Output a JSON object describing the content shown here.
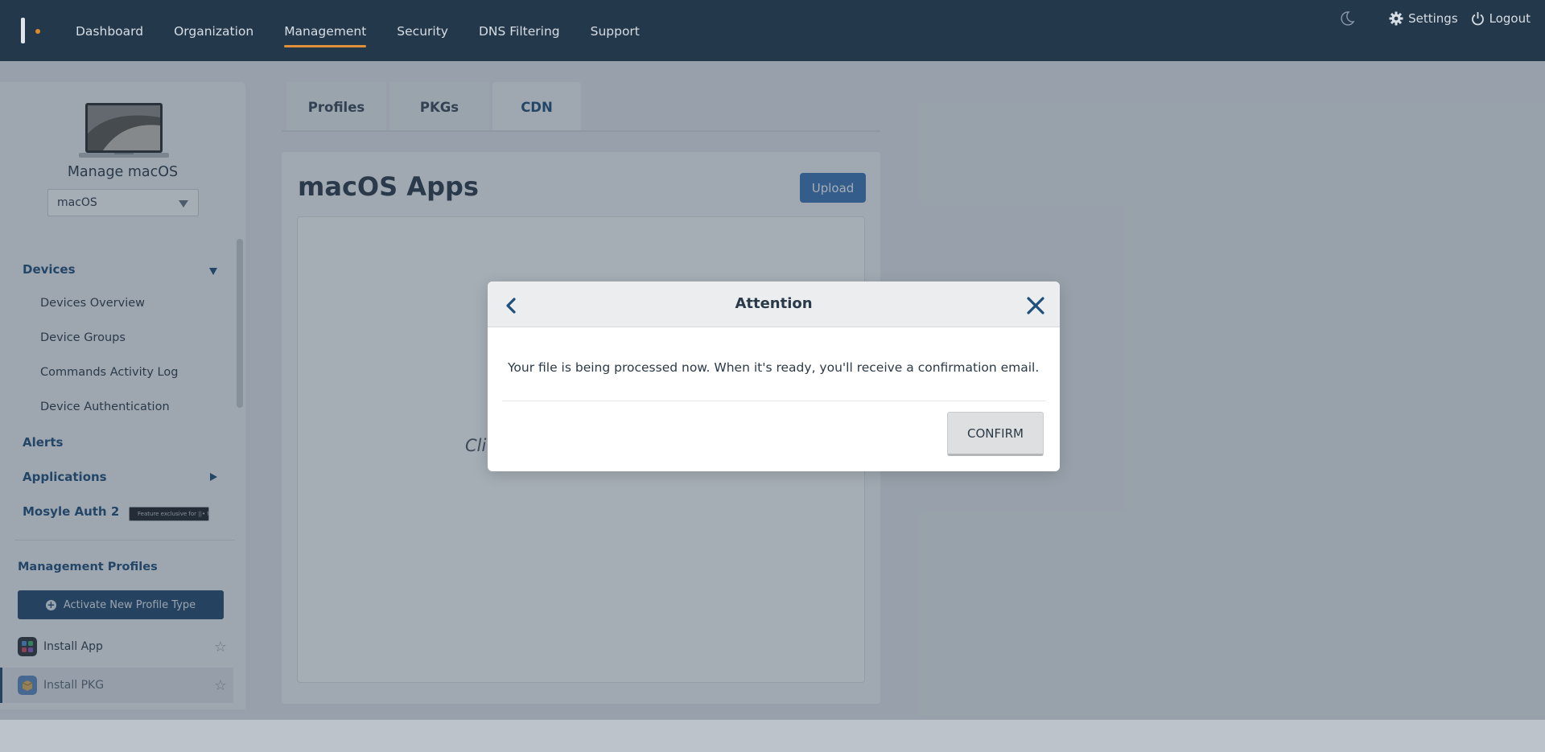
{
  "nav": {
    "items": [
      {
        "label": "Dashboard"
      },
      {
        "label": "Organization"
      },
      {
        "label": "Management"
      },
      {
        "label": "Security"
      },
      {
        "label": "DNS Filtering"
      },
      {
        "label": "Support"
      }
    ],
    "active": "Management",
    "settings_label": "Settings",
    "logout_label": "Logout"
  },
  "sidebar": {
    "title": "Manage macOS",
    "os_select_value": "macOS",
    "devices_label": "Devices",
    "device_items": [
      {
        "label": "Devices Overview"
      },
      {
        "label": "Device Groups"
      },
      {
        "label": "Commands Activity Log"
      },
      {
        "label": "Device Authentication"
      }
    ],
    "alerts_label": "Alerts",
    "applications_label": "Applications",
    "mosyle_auth_label": "Mosyle Auth 2",
    "fuse_badge_text": "Feature exclusive for ||• fuse",
    "management_profiles_label": "Management Profiles",
    "activate_button_label": "Activate New Profile Type",
    "profiles": [
      {
        "label": "Install App"
      },
      {
        "label": "Install PKG"
      }
    ]
  },
  "main": {
    "tabs": [
      {
        "label": "Profiles"
      },
      {
        "label": "PKGs"
      },
      {
        "label": "CDN"
      }
    ],
    "active_tab": "CDN",
    "title": "macOS Apps",
    "upload_label": "Upload",
    "dropzone_text": "Cli"
  },
  "modal": {
    "title": "Attention",
    "message": "Your file is being processed now. When it's ready, you'll receive a confirmation email.",
    "confirm_label": "CONFIRM"
  },
  "colors": {
    "topbar": "#24384b",
    "accent_underline": "#e0903a",
    "brand_blue": "#1f4f7a",
    "upload_blue": "#3d76b8"
  },
  "icons": [
    "moon-icon",
    "gear-icon",
    "power-icon",
    "chevron-left-icon",
    "close-icon",
    "star-icon",
    "plus-circle-icon"
  ]
}
